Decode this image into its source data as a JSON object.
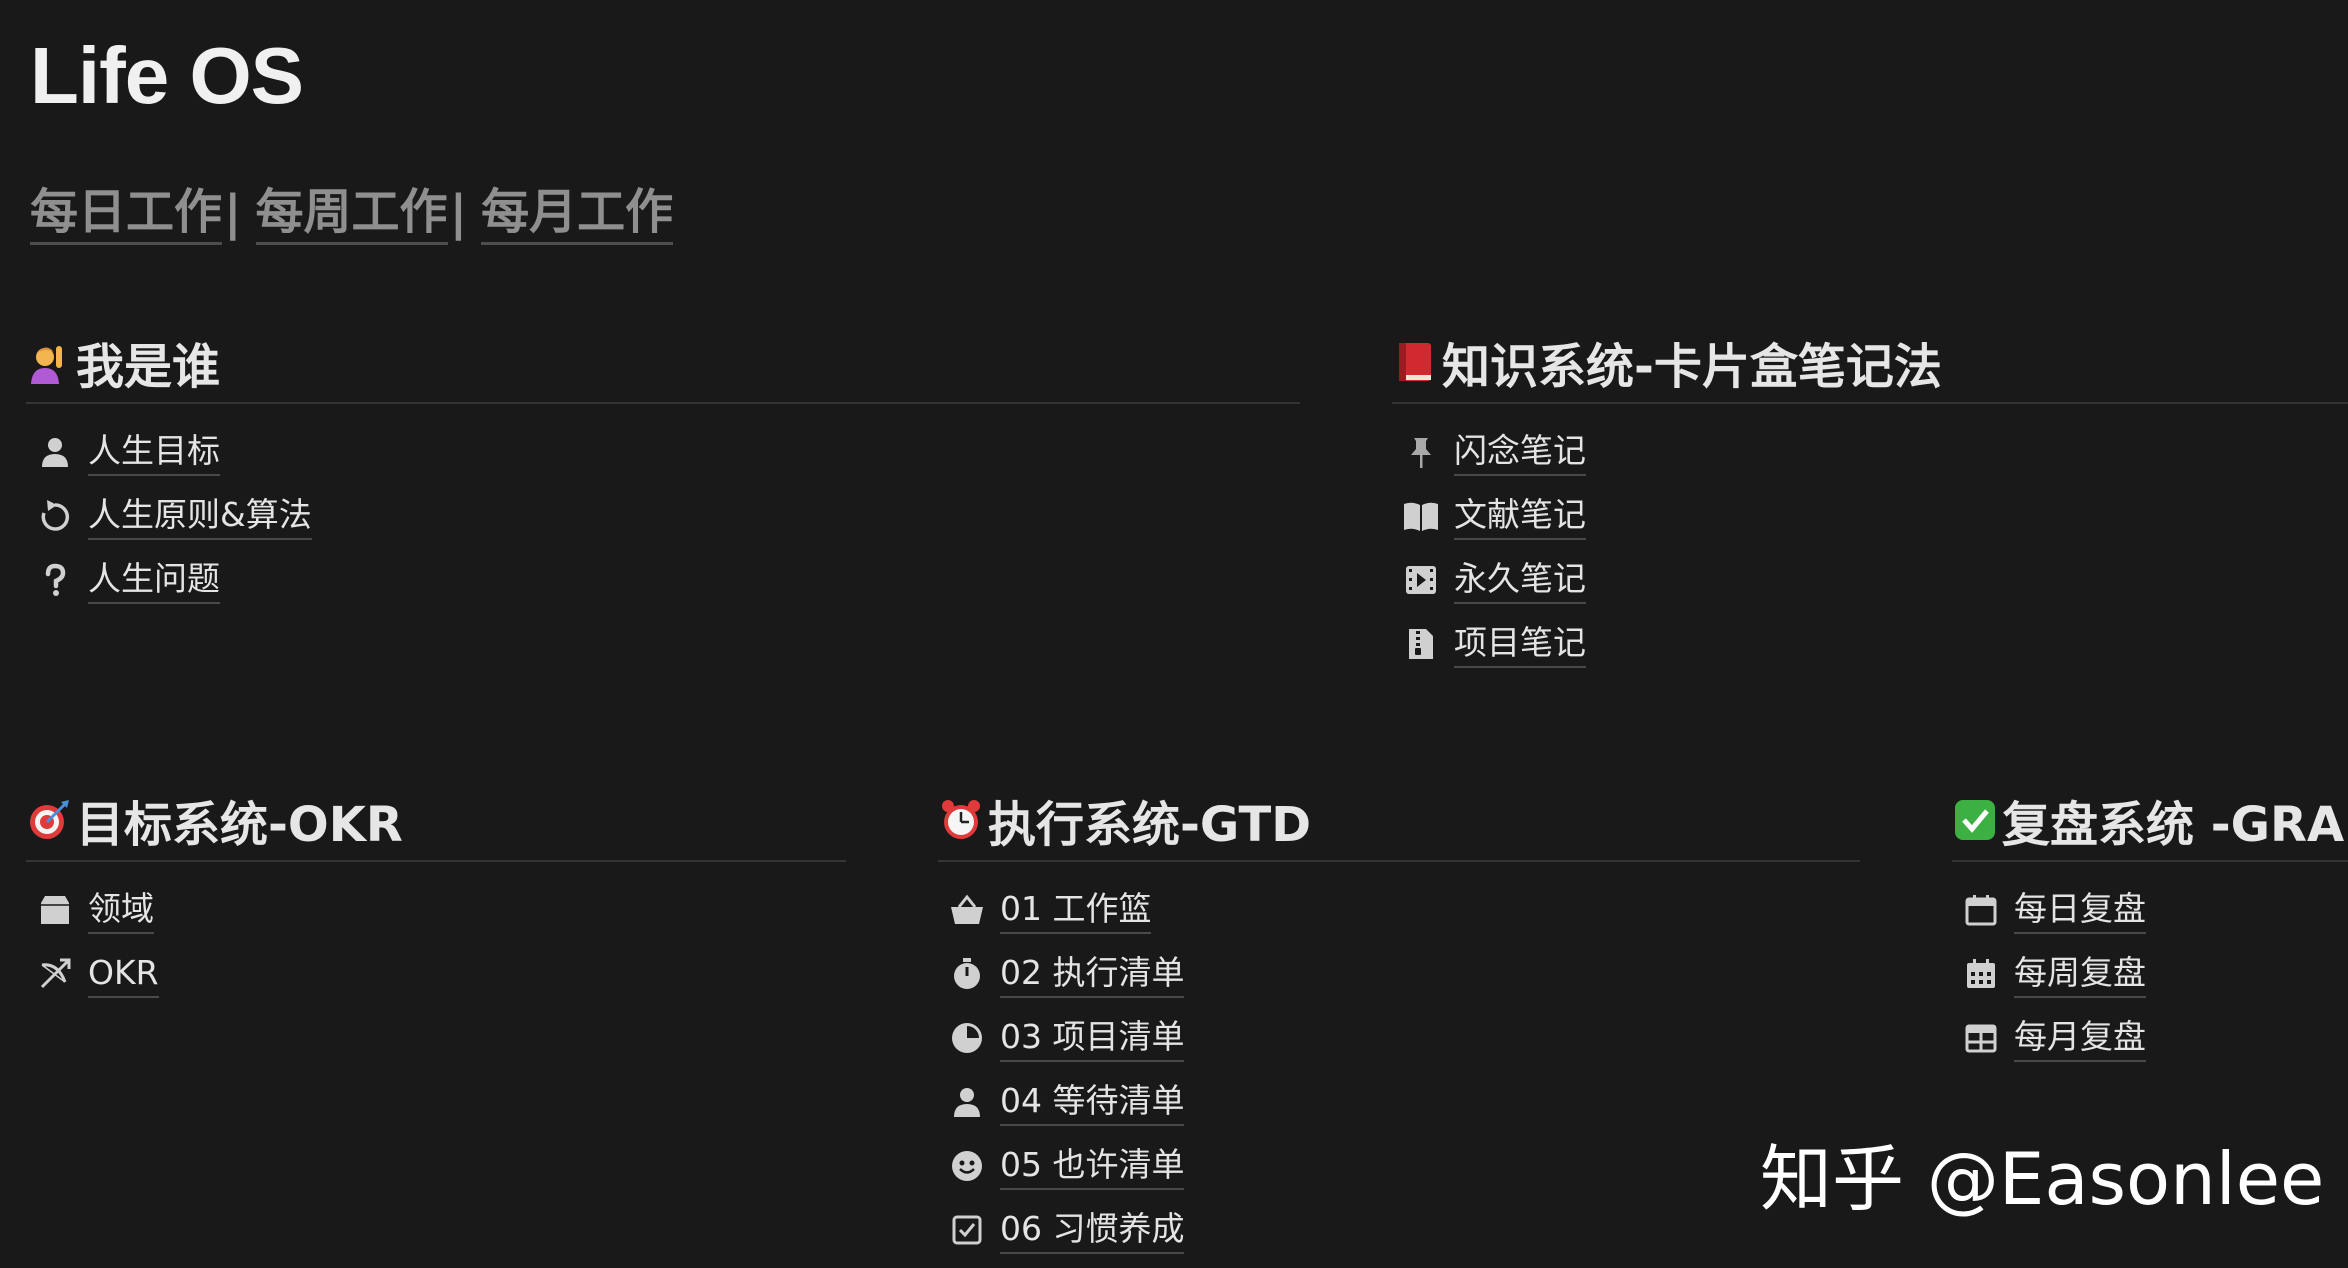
{
  "page": {
    "title": "Life OS"
  },
  "quicklinks": [
    {
      "label": "每日工作",
      "sep": "|"
    },
    {
      "label": "每周工作",
      "sep": "|"
    },
    {
      "label": "每月工作",
      "sep": ""
    }
  ],
  "sections": {
    "who": {
      "title": "我是谁",
      "emoji": "person-raising-hand-icon",
      "items": [
        {
          "label": "人生目标",
          "icon": "person-icon"
        },
        {
          "label": "人生原则&算法",
          "icon": "rotate-arrow-icon"
        },
        {
          "label": "人生问题",
          "icon": "question-mark-icon"
        }
      ]
    },
    "knowledge": {
      "title": "知识系统-卡片盒笔记法",
      "emoji": "red-book-icon",
      "items": [
        {
          "label": "闪念笔记",
          "icon": "pin-icon"
        },
        {
          "label": "文献笔记",
          "icon": "open-book-icon"
        },
        {
          "label": "永久笔记",
          "icon": "film-icon"
        },
        {
          "label": "项目笔记",
          "icon": "zipper-file-icon"
        }
      ]
    },
    "okr": {
      "title": "目标系统-OKR",
      "emoji": "dart-target-icon",
      "items": [
        {
          "label": "领域",
          "icon": "archive-icon"
        },
        {
          "label": "OKR",
          "icon": "bow-arrow-icon"
        }
      ]
    },
    "gtd": {
      "title": "执行系统-GTD",
      "emoji": "alarm-clock-icon",
      "items": [
        {
          "label": "01 工作篮",
          "icon": "basket-icon"
        },
        {
          "label": "02 执行清单",
          "icon": "stopwatch-icon"
        },
        {
          "label": "03 项目清单",
          "icon": "pie-clock-icon"
        },
        {
          "label": "04 等待清单",
          "icon": "person-icon"
        },
        {
          "label": "05 也许清单",
          "icon": "smiley-icon"
        },
        {
          "label": "06 习惯养成",
          "icon": "checkbox-icon"
        }
      ]
    },
    "review": {
      "title": "复盘系统 -GRAI",
      "emoji": "check-mark-button-icon",
      "items": [
        {
          "label": "每日复盘",
          "icon": "calendar-icon"
        },
        {
          "label": "每周复盘",
          "icon": "calendar-grid-icon"
        },
        {
          "label": "每月复盘",
          "icon": "table-icon"
        }
      ]
    }
  },
  "watermark": {
    "text": "知乎 @Easonlee"
  },
  "colors": {
    "background": "#191919",
    "text": "#e6e6e6",
    "muted": "#8f8f8f",
    "divider": "#343434"
  }
}
